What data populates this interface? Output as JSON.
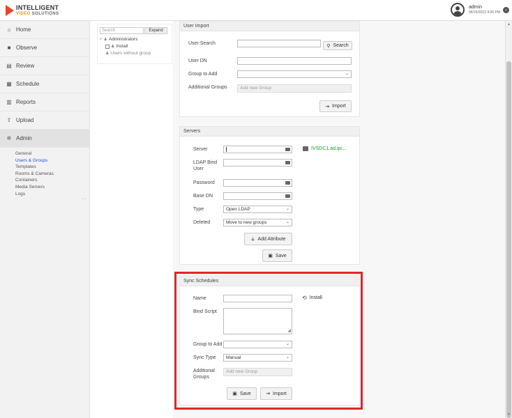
{
  "header": {
    "brand_line1": "INTELLIGENT",
    "brand_line2a": "VIDEO",
    "brand_line2b": "SOLUTIONS",
    "user": "admin",
    "datetime": "06/15/2022 4:06 PM"
  },
  "sidebar": {
    "items": [
      {
        "label": "Home",
        "icon": "home-icon",
        "glyph": "⌂"
      },
      {
        "label": "Observe",
        "icon": "video-camera-icon",
        "glyph": "■"
      },
      {
        "label": "Review",
        "icon": "film-icon",
        "glyph": "▤"
      },
      {
        "label": "Schedule",
        "icon": "calendar-icon",
        "glyph": "▦"
      },
      {
        "label": "Reports",
        "icon": "bar-chart-icon",
        "glyph": "▥"
      },
      {
        "label": "Upload",
        "icon": "upload-icon",
        "glyph": "⇧"
      },
      {
        "label": "Admin",
        "icon": "gear-icon",
        "glyph": "✲"
      }
    ],
    "admin_sub": [
      "General",
      "Users & Groups",
      "Templates",
      "Rooms & Cameras",
      "Containers",
      "Media Servers",
      "Logs"
    ],
    "active_sub": "Users & Groups"
  },
  "tree": {
    "search_placeholder": "Search",
    "expand_label": "Expand",
    "root": "Administrators",
    "child": "Install",
    "other": "Users without group"
  },
  "user_import": {
    "title": "User Import",
    "user_search_label": "User Search",
    "search_button": "Search",
    "user_dn_label": "User DN",
    "group_to_add_label": "Group to Add",
    "additional_groups_label": "Additional Groups",
    "additional_groups_placeholder": "Add new Group",
    "import_button": "Import"
  },
  "servers": {
    "title": "Servers",
    "server_label": "Server",
    "ldap_bind_user_label_1": "LDAP Bind",
    "ldap_bind_user_label_2": "User",
    "password_label": "Password",
    "base_dn_label": "Base DN",
    "type_label": "Type",
    "type_value": "Open LDAP",
    "deleted_label": "Deleted",
    "deleted_value": "Move to new groups",
    "server_link": "IVSDC1.ad.ipi....",
    "add_attribute_button": "Add Attribute",
    "save_button": "Save"
  },
  "sync_schedules": {
    "title": "Sync Schedules",
    "name_label": "Name",
    "install_link": "Install",
    "bind_script_label": "Bind Script",
    "group_to_add_label": "Group to Add",
    "sync_type_label": "Sync Type",
    "sync_type_value": "Manual",
    "additional_groups_label_1": "Additional",
    "additional_groups_label_2": "Groups",
    "additional_groups_placeholder": "Add new Group",
    "save_button": "Save",
    "import_button": "Import"
  },
  "colors": {
    "highlight": "#e3242b",
    "link_active": "#2a4fd0",
    "server_link": "#1a9a1a",
    "brand_orange": "#e8452c"
  }
}
